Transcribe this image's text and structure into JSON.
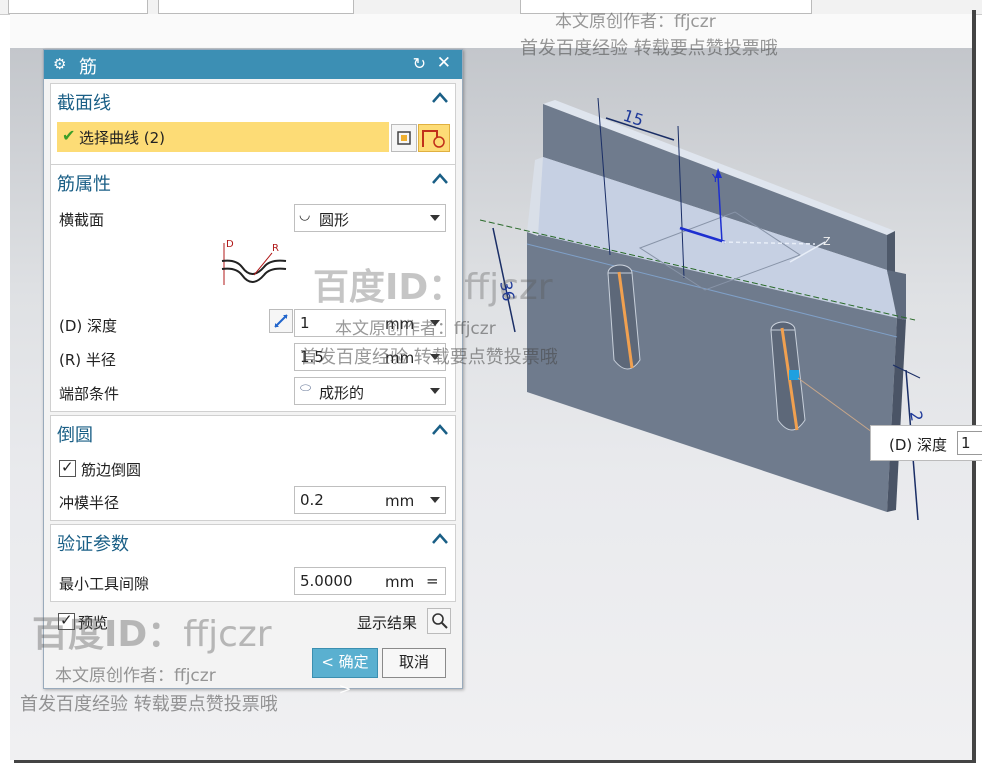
{
  "dialog": {
    "title": "筋",
    "sections": {
      "section_curve": {
        "title": "截面线",
        "select_label": "选择曲线 (2)"
      },
      "properties": {
        "title": "筋属性",
        "cross_section_label": "横截面",
        "cross_section_value": "圆形",
        "diagram_labels": {
          "d": "D",
          "r": "R"
        },
        "depth_label": "(D) 深度",
        "depth_value": "1",
        "depth_unit": "mm",
        "radius_label": "(R) 半径",
        "radius_value": "1.5",
        "radius_unit": "mm",
        "end_label": "端部条件",
        "end_value": "成形的"
      },
      "fillet": {
        "title": "倒圆",
        "edge_fillet_label": "筋边倒圆",
        "edge_fillet_checked": true,
        "punch_radius_label": "冲模半径",
        "punch_radius_value": "0.2",
        "punch_radius_unit": "mm"
      },
      "verify": {
        "title": "验证参数",
        "min_gap_label": "最小工具间隙",
        "min_gap_value": "5.0000",
        "min_gap_unit": "mm",
        "min_gap_op": "="
      }
    },
    "footer": {
      "preview_label": "预览",
      "preview_checked": true,
      "show_result_label": "显示结果",
      "ok_label": "< 确定 >",
      "cancel_label": "取消"
    }
  },
  "viewport": {
    "dim_top": "15",
    "dim_left": "36",
    "dim_right": "2",
    "axis_y": "Y",
    "axis_z": "Z",
    "tooltip_label": "(D) 深度",
    "tooltip_value": "1"
  },
  "watermarks": {
    "author_line": "本文原创作者：ffjczr",
    "promo_line": "首发百度经验 转载要点赞投票哦",
    "id_label": "百度ID：",
    "id_value": "ffjczr"
  },
  "colors": {
    "title_bar": "#3c8fb4",
    "section_title": "#1a5f86",
    "selection_highlight": "#fddc76",
    "ok_button": "#5ab0d0",
    "rib_orange": "#f0a050",
    "dimension_blue": "#1f3a9a"
  }
}
